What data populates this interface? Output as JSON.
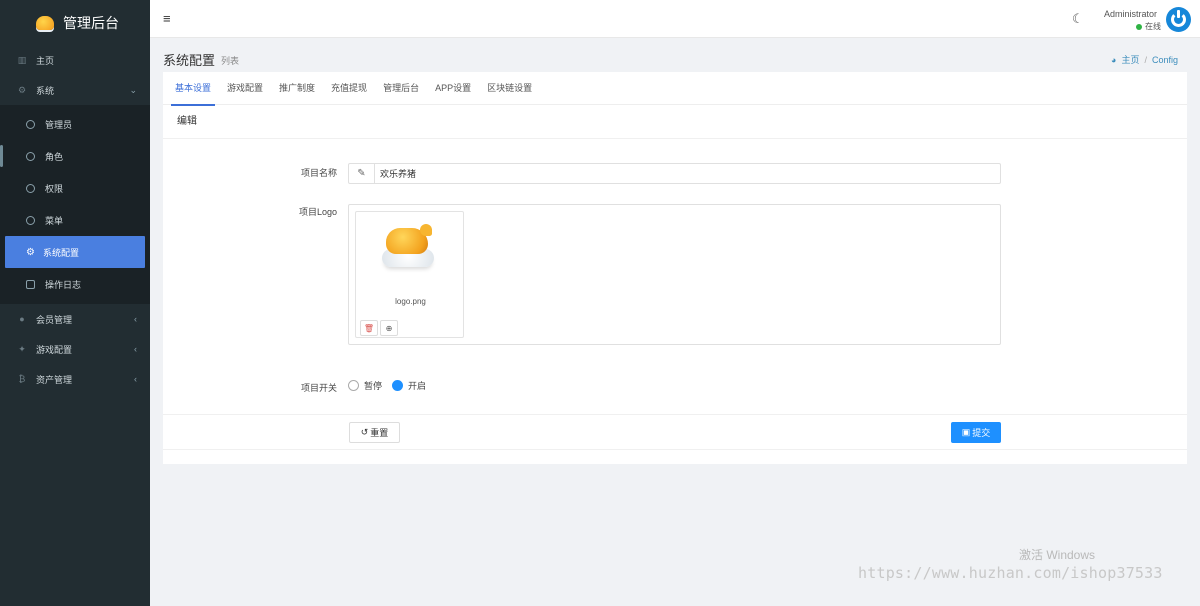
{
  "brand": {
    "title": "管理后台"
  },
  "sidebar": {
    "items": [
      {
        "label": "主页",
        "icon": "bar-chart-icon"
      },
      {
        "label": "系统",
        "icon": "gear-icon"
      },
      {
        "label": "会员管理",
        "icon": "user-icon"
      },
      {
        "label": "游戏配置",
        "icon": "gamepad-icon"
      },
      {
        "label": "资产管理",
        "icon": "bitcoin-icon"
      }
    ],
    "sub_items": [
      {
        "label": "管理员"
      },
      {
        "label": "角色"
      },
      {
        "label": "权限"
      },
      {
        "label": "菜单"
      },
      {
        "label": "系统配置"
      },
      {
        "label": "操作日志"
      }
    ]
  },
  "topbar": {
    "user_name": "Administrator",
    "user_status": "在线"
  },
  "page": {
    "title": "系统配置",
    "subtitle": "列表"
  },
  "breadcrumb": {
    "home": "主页",
    "sep": "/",
    "current": "Config"
  },
  "tabs": [
    "基本设置",
    "游戏配置",
    "推广制度",
    "充值提现",
    "管理后台",
    "APP设置",
    "区块链设置"
  ],
  "form": {
    "section_title": "编辑",
    "name_label": "项目名称",
    "name_value": "欢乐养猪",
    "logo_label": "项目Logo",
    "logo_filename": "logo.png",
    "switch_label": "项目开关",
    "options": [
      "暂停",
      "开启"
    ],
    "selected_option": "开启",
    "reset_label": "重置",
    "submit_label": "提交"
  },
  "watermark": {
    "windows": "激活 Windows",
    "url": "https://www.huzhan.com/ishop37533"
  },
  "colors": {
    "accent": "#1e90ff",
    "sidebar_bg": "#222d32",
    "active_item": "#4a7fe0",
    "online": "#2fb344"
  }
}
